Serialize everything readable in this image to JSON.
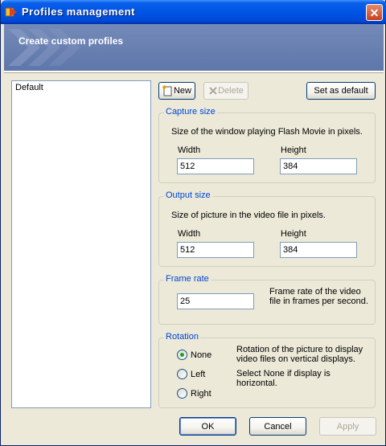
{
  "window": {
    "title": "Profiles management",
    "close_glyph": "✕"
  },
  "banner": {
    "heading": "Create custom profiles"
  },
  "profiles": {
    "items": [
      "Default"
    ]
  },
  "toolbar": {
    "new_label": "New",
    "delete_label": "Delete",
    "set_default_label": "Set as default"
  },
  "capture_size": {
    "legend": "Capture size",
    "description": "Size of the window playing Flash Movie in pixels.",
    "width_label": "Width",
    "height_label": "Height",
    "width_value": "512",
    "height_value": "384"
  },
  "output_size": {
    "legend": "Output size",
    "description": "Size of picture in the video file in pixels.",
    "width_label": "Width",
    "height_label": "Height",
    "width_value": "512",
    "height_value": "384"
  },
  "frame_rate": {
    "legend": "Frame rate",
    "value": "25",
    "description": "Frame rate of the video file in frames per second."
  },
  "rotation": {
    "legend": "Rotation",
    "options": [
      "None",
      "Left",
      "Right"
    ],
    "selected": "None",
    "description1": "Rotation of the picture to display video files on vertical displays.",
    "description2": "Select None if display is horizontal."
  },
  "footer": {
    "ok_label": "OK",
    "cancel_label": "Cancel",
    "apply_label": "Apply"
  },
  "colors": {
    "title_bar": "#0055e5",
    "banner": "#6a80b2",
    "group_legend": "#0046d5",
    "radio_dot": "#21a121"
  }
}
